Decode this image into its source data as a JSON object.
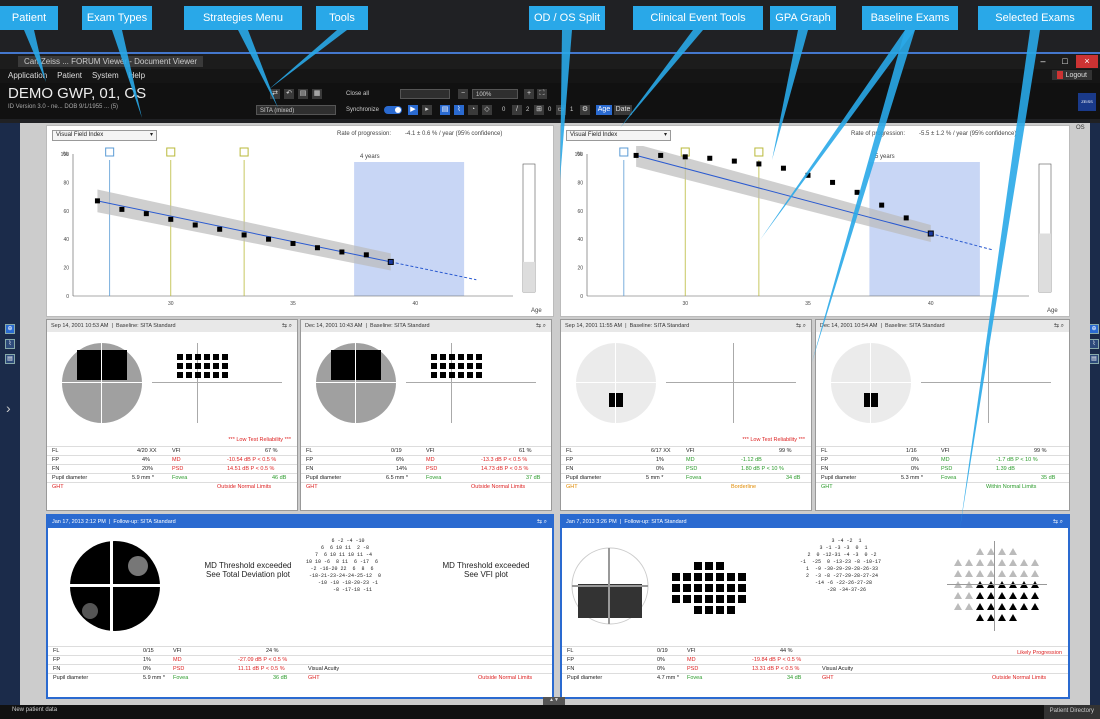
{
  "window": {
    "title": "Carl Zeiss ... FORUM Viewer - Document Viewer"
  },
  "menu": [
    "Application",
    "Patient",
    "System",
    "Help"
  ],
  "patient": {
    "name": "DEMO GWP, 01, OS",
    "info": "ID Version 3.0 - ne...    DOB 9/1/1955 ... (5)"
  },
  "header": {
    "login_frag": "n",
    "logout": "Logout",
    "zeiss": "ZEISS"
  },
  "toolbar": {
    "close_all": "Close all",
    "zoom": "100%",
    "strategy": "SITA (mixed)",
    "synchronize": "Synchronize",
    "age": "Age",
    "date": "Date",
    "counts": [
      "0",
      "2",
      "0",
      "1",
      "0"
    ]
  },
  "sides": {
    "od": "OD",
    "os": "OS"
  },
  "od": {
    "dropdown": "Visual Field Index",
    "rate_label": "Rate of progression:",
    "rate_value": "-4.1 ± 0.6 % / year (95% confidence)",
    "years": "4 years",
    "pct": "%",
    "yticks": [
      "100",
      "80",
      "60",
      "40",
      "20",
      "0"
    ],
    "xticks": [
      "30",
      "35",
      "40"
    ],
    "age": "Age",
    "exams": [
      {
        "date": "Sep 14, 2001 10:53 AM",
        "type": "Baseline: SITA Standard",
        "warn": "*** Low Test Reliability ***",
        "fl": "4/20 XX",
        "fp": "4%",
        "fn": "20%",
        "pupil": "5.9 mm *",
        "vfi": "67 %",
        "md": "-10.54 dB P < 0.5 %",
        "psd": "14.51 dB P < 0.5 %",
        "fovea": "46 dB",
        "ght": "Outside Normal Limits"
      },
      {
        "date": "Dec 14, 2001 10:43 AM",
        "type": "Baseline: SITA Standard",
        "warn": "",
        "fl": "0/19",
        "fp": "6%",
        "fn": "14%",
        "pupil": "6.5 mm *",
        "vfi": "61 %",
        "md": "-13.3 dB P < 0.5 %",
        "psd": "14.73 dB P < 0.5 %",
        "fovea": "37 dB",
        "ght": "Outside Normal Limits"
      }
    ],
    "followup": {
      "date": "Jan 17, 2013 2:12 PM",
      "type": "Follow-up: SITA Standard",
      "msg1": "MD Threshold exceeded\nSee Total Deviation plot",
      "msg2": "MD Threshold exceeded\nSee VFI plot",
      "grid": "    6 -2 -4 -10\n  6  6 10 11  2 -8\n 7  6 10 11 10 11 -4\n10 10 -6  8 11  6 -17  6\n-2 -16-20 22  6  8  6\n  -18-21-23-24-24-25-12  0\n    -10 -10 -18-20-23 -1\n       -8 -17-18 -11",
      "fl": "0/15",
      "fp": "1%",
      "fn": "0%",
      "pupil": "5.9 mm *",
      "vfi": "24 %",
      "md": "-27.09 dB P < 0.5 %",
      "psd": "11.11 dB P < 0.5 %",
      "fovea": "36 dB",
      "va": "Visual Acuity",
      "ght": "Outside Normal Limits"
    }
  },
  "os": {
    "dropdown": "Visual Field Index",
    "rate_label": "Rate of progression:",
    "rate_value": "-5.5 ± 1.2 % / year (95% confidence)",
    "years": "5 years",
    "pct": "%",
    "yticks": [
      "100",
      "80",
      "60",
      "40",
      "20",
      "0"
    ],
    "xticks": [
      "30",
      "35",
      "40"
    ],
    "age": "Age",
    "exams": [
      {
        "date": "Sep 14, 2001 11:55 AM",
        "type": "Baseline: SITA Standard",
        "warn": "*** Low Test Reliability ***",
        "fl": "6/17 XX",
        "fp": "1%",
        "fn": "0%",
        "pupil": "5 mm *",
        "vfi": "99 %",
        "md": "-1.12 dB",
        "psd": "1.80 dB P < 10 %",
        "fovea": "34 dB",
        "ght": "Borderline"
      },
      {
        "date": "Dec 14, 2001 10:54 AM",
        "type": "Baseline: SITA Standard",
        "warn": "",
        "fl": "1/16",
        "fp": "0%",
        "fn": "0%",
        "pupil": "5.3 mm *",
        "vfi": "99 %",
        "md": "-1.7 dB P < 10 %",
        "psd": "1.39 dB",
        "fovea": "35 dB",
        "ght": "Within Normal Limits"
      }
    ],
    "followup": {
      "date": "Jan 7, 2013 3:26 PM",
      "type": "Follow-up: SITA Standard",
      "grid": "    3 -4 -2  1\n  3 -1 -3 -3  0  1\n 2  0 -12-31 -4 -3  0 -2\n-1  -25  0 -13-23 -8 -10-17\n 1  -9 -30-29-29-28-26-33\n 2  -3 -8 -27-29-28-27-24\n  -14 -6 -22-26-27-28\n    -28 -34-37-26",
      "fl": "0/19",
      "fp": "0%",
      "fn": "0%",
      "pupil": "4.7 mm *",
      "vfi": "44 %",
      "md": "-19.84 dB P < 0.5 %",
      "psd": "13.31 dB P < 0.5 %",
      "fovea": "34 dB",
      "va": "Visual Acuity",
      "ght": "Outside Normal Limits",
      "likely": "Likely Progression"
    }
  },
  "labels": {
    "fl": "FL",
    "fp": "FP",
    "fn": "FN",
    "pupil": "Pupil diameter",
    "vfi": "VFI",
    "md": "MD",
    "psd": "PSD",
    "fovea": "Fovea",
    "ght": "GHT"
  },
  "callouts": [
    {
      "id": "patient",
      "text": "Patient"
    },
    {
      "id": "exam-types",
      "text": "Exam Types"
    },
    {
      "id": "strategies",
      "text": "Strategies Menu"
    },
    {
      "id": "tools",
      "text": "Tools"
    },
    {
      "id": "odos",
      "text": "OD / OS Split"
    },
    {
      "id": "clinical",
      "text": "Clinical Event Tools"
    },
    {
      "id": "gpa",
      "text": "GPA Graph"
    },
    {
      "id": "baseline",
      "text": "Baseline Exams"
    },
    {
      "id": "selected",
      "text": "Selected Exams"
    }
  ],
  "status": {
    "left": "New patient data",
    "right": "Patient Directory"
  },
  "chart_data": [
    {
      "type": "scatter",
      "title": "",
      "ylabel": "%",
      "xlabel": "Age",
      "ylim": [
        0,
        100
      ],
      "xlim": [
        26,
        44
      ],
      "x": [
        27,
        28,
        29,
        30,
        31,
        32,
        33,
        34,
        35,
        36,
        37,
        38,
        39
      ],
      "y": [
        67,
        61,
        58,
        54,
        50,
        47,
        43,
        40,
        37,
        34,
        31,
        29,
        24
      ]
    },
    {
      "type": "scatter",
      "title": "",
      "ylabel": "%",
      "xlabel": "Age",
      "ylim": [
        0,
        100
      ],
      "xlim": [
        26,
        44
      ],
      "x": [
        28,
        29,
        30,
        31,
        32,
        33,
        34,
        35,
        36,
        37,
        38,
        39,
        40
      ],
      "y": [
        99,
        99,
        98,
        97,
        95,
        93,
        90,
        85,
        80,
        73,
        64,
        55,
        44
      ]
    }
  ]
}
